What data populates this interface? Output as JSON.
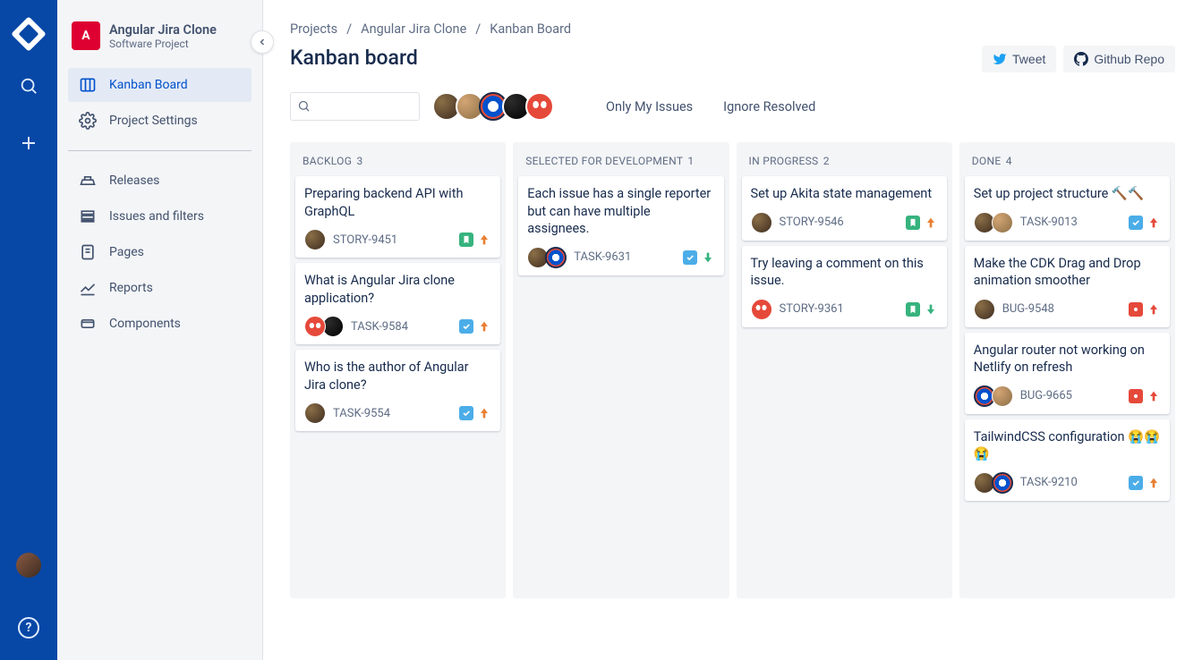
{
  "project": {
    "name": "Angular Jira Clone",
    "type": "Software Project"
  },
  "sidebar": {
    "items": [
      {
        "label": "Kanban Board",
        "active": true
      },
      {
        "label": "Project Settings",
        "active": false
      }
    ],
    "secondary": [
      {
        "label": "Releases"
      },
      {
        "label": "Issues and filters"
      },
      {
        "label": "Pages"
      },
      {
        "label": "Reports"
      },
      {
        "label": "Components"
      }
    ]
  },
  "breadcrumb": {
    "root": "Projects",
    "project": "Angular Jira Clone",
    "page": "Kanban Board"
  },
  "page": {
    "title": "Kanban board"
  },
  "actions": {
    "tweet": "Tweet",
    "github": "Github Repo"
  },
  "filters": {
    "onlyMine": "Only My Issues",
    "ignoreResolved": "Ignore Resolved",
    "searchPlaceholder": ""
  },
  "avatars": [
    "av-1",
    "av-2",
    "av-3",
    "av-4",
    "av-5"
  ],
  "columns": [
    {
      "title": "Backlog",
      "count": 3,
      "cards": [
        {
          "title": "Preparing backend API with GraphQL",
          "key": "STORY-9451",
          "type": "story",
          "priority": "up-orange",
          "assignees": [
            "av-1"
          ]
        },
        {
          "title": "What is Angular Jira clone application?",
          "key": "TASK-9584",
          "type": "task",
          "priority": "up-orange",
          "assignees": [
            "av-5",
            "av-4"
          ]
        },
        {
          "title": "Who is the author of Angular Jira clone?",
          "key": "TASK-9554",
          "type": "task",
          "priority": "up-orange",
          "assignees": [
            "av-1"
          ]
        }
      ]
    },
    {
      "title": "Selected for Development",
      "count": 1,
      "cards": [
        {
          "title": "Each issue has a single reporter but can have multiple assignees.",
          "key": "TASK-9631",
          "type": "task",
          "priority": "down-green",
          "assignees": [
            "av-1",
            "av-3"
          ]
        }
      ]
    },
    {
      "title": "In Progress",
      "count": 2,
      "cards": [
        {
          "title": "Set up Akita state management",
          "key": "STORY-9546",
          "type": "story",
          "priority": "up-orange",
          "assignees": [
            "av-1"
          ]
        },
        {
          "title": "Try leaving a comment on this issue.",
          "key": "STORY-9361",
          "type": "story",
          "priority": "down-green",
          "assignees": [
            "av-5"
          ]
        }
      ]
    },
    {
      "title": "Done",
      "count": 4,
      "cards": [
        {
          "title": "Set up project structure 🔨🔨",
          "key": "TASK-9013",
          "type": "task",
          "priority": "up-red",
          "assignees": [
            "av-1",
            "av-2"
          ]
        },
        {
          "title": "Make the CDK Drag and Drop animation smoother",
          "key": "BUG-9548",
          "type": "bug",
          "priority": "up-red",
          "assignees": [
            "av-1"
          ]
        },
        {
          "title": "Angular router not working on Netlify on refresh",
          "key": "BUG-9665",
          "type": "bug",
          "priority": "up-red",
          "assignees": [
            "av-3",
            "av-2"
          ]
        },
        {
          "title": "TailwindCSS configuration 😭😭😭",
          "key": "TASK-9210",
          "type": "task",
          "priority": "up-orange",
          "assignees": [
            "av-1",
            "av-3"
          ]
        }
      ]
    }
  ]
}
